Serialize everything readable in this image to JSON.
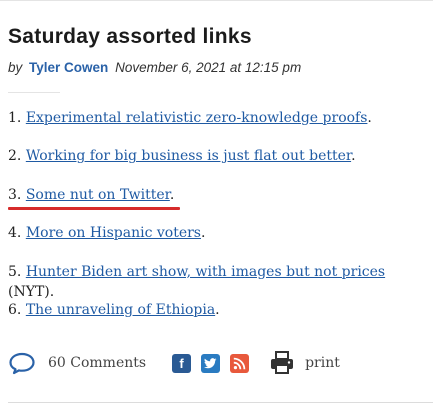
{
  "post": {
    "title": "Saturday assorted links",
    "by_label": "by",
    "author": "Tyler Cowen",
    "date": "November 6, 2021 at 12:15 pm"
  },
  "links": [
    {
      "num": "1.",
      "text": "Experimental relativistic zero-knowledge proofs",
      "suffix": "."
    },
    {
      "num": "2.",
      "text": "Working for big business is just flat out better",
      "suffix": "."
    },
    {
      "num": "3.",
      "text": "Some nut on Twitter",
      "suffix": "."
    },
    {
      "num": "4.",
      "text": "More on Hispanic voters",
      "suffix": "."
    },
    {
      "num": "5.",
      "text": "Hunter Biden art show, with images but not prices",
      "suffix": " (NYT)."
    },
    {
      "num": "6.",
      "text": "The unraveling of Ethiopia",
      "suffix": "."
    }
  ],
  "footer": {
    "comments": "60 Comments",
    "print": "print",
    "facebook_glyph": "f",
    "icons": [
      "comment-icon",
      "facebook-icon",
      "twitter-icon",
      "rss-icon",
      "print-icon"
    ]
  },
  "colors": {
    "link": "#1f5aa3",
    "author": "#2a62a8",
    "highlight_underline": "#d62b2b",
    "facebook": "#2a5a94",
    "twitter": "#2a7bc1",
    "rss": "#e8593c"
  }
}
